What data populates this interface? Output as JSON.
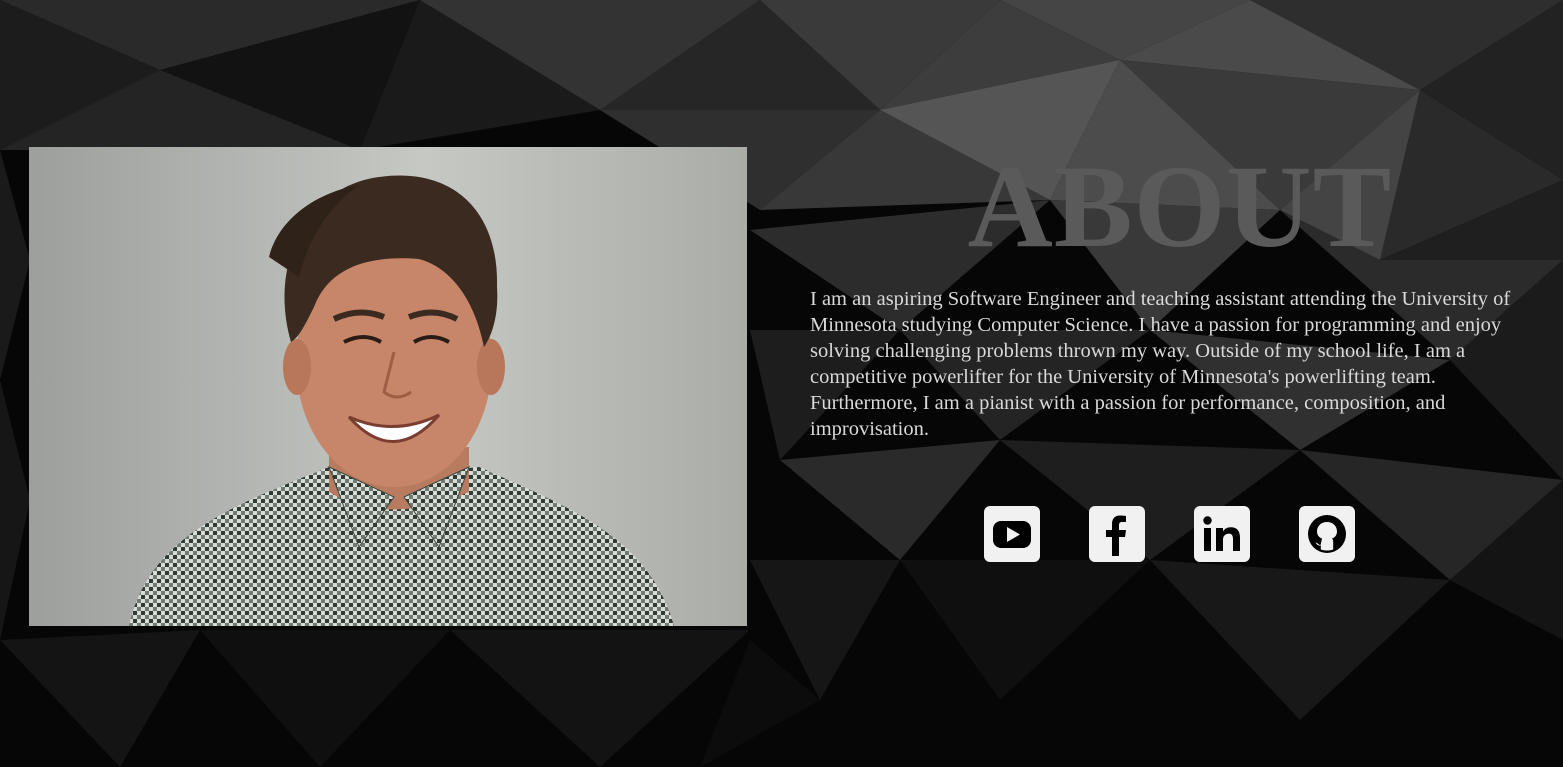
{
  "about": {
    "title": "ABOUT",
    "description": "I am an aspiring Software Engineer and teaching assistant attending the University of Minnesota studying Computer Science. I have a passion for programming and enjoy solving challenging problems thrown my way. Outside of my school life, I am a competitive powerlifter for the University of Minnesota's powerlifting team. Furthermore, I am a pianist with a passion for performance, composition, and improvisation."
  },
  "socials": [
    {
      "icon": "youtube-icon"
    },
    {
      "icon": "facebook-icon"
    },
    {
      "icon": "linkedin-icon"
    },
    {
      "icon": "github-icon"
    }
  ],
  "colors": {
    "background": "#050505",
    "title": "#5a5a5a",
    "text": "#d9d9d9",
    "icon_bg": "#f1f1f1"
  }
}
